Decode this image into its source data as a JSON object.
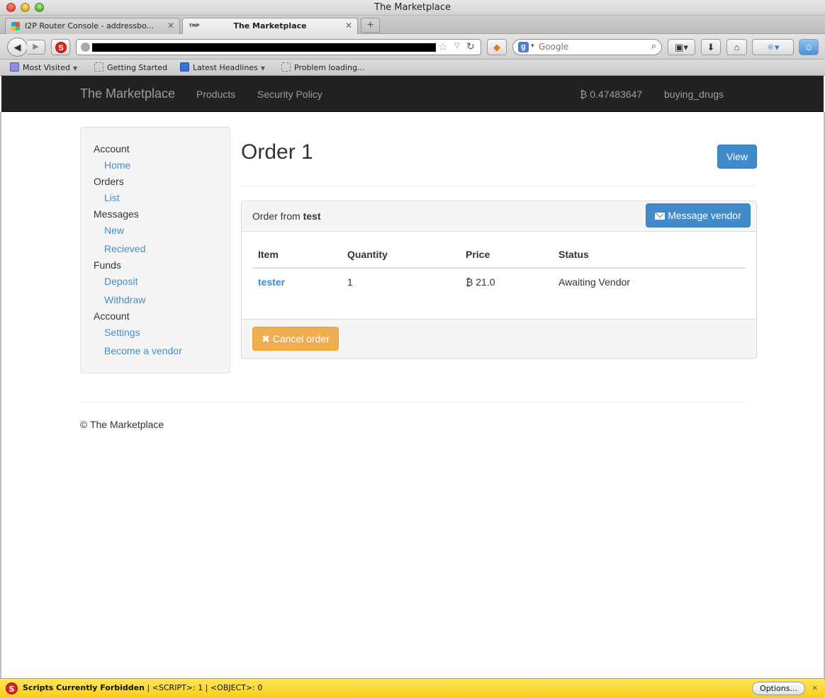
{
  "window": {
    "title": "The Marketplace"
  },
  "tabs": [
    {
      "label": "I2P Router Console - addressbo...",
      "favicon": "i2p-icon"
    },
    {
      "label": "The Marketplace",
      "favicon": "tmp-icon",
      "favicon_text": "TMP"
    }
  ],
  "toolbar": {
    "search_placeholder": "Google",
    "search_engine_letter": "g"
  },
  "bookmarks": [
    {
      "label": "Most Visited",
      "icon": "folder-icon"
    },
    {
      "label": "Getting Started",
      "icon": "bookmark-icon"
    },
    {
      "label": "Latest Headlines",
      "icon": "rss-icon"
    },
    {
      "label": "Problem loading...",
      "icon": "bookmark-icon"
    }
  ],
  "site_nav": {
    "brand": "The Marketplace",
    "links": [
      "Products",
      "Security Policy"
    ],
    "balance": "₿ 0.47483647",
    "username": "buying_drugs"
  },
  "sidebar": {
    "sections": [
      {
        "heading": "Account",
        "links": [
          "Home"
        ]
      },
      {
        "heading": "Orders",
        "links": [
          "List"
        ]
      },
      {
        "heading": "Messages",
        "links": [
          "New",
          "Recieved"
        ]
      },
      {
        "heading": "Funds",
        "links": [
          "Deposit",
          "Withdraw"
        ]
      },
      {
        "heading": "Account",
        "links": [
          "Settings",
          "Become a vendor"
        ]
      }
    ]
  },
  "main": {
    "title": "Order 1",
    "view_button": "View",
    "panel": {
      "heading_prefix": "Order from",
      "vendor": "test",
      "message_button": "Message vendor",
      "columns": [
        "Item",
        "Quantity",
        "Price",
        "Status"
      ],
      "rows": [
        {
          "item": "tester",
          "quantity": "1",
          "price": "₿ 21.0",
          "status": "Awaiting Vendor"
        }
      ],
      "cancel_button": "✖ Cancel order"
    }
  },
  "footer": {
    "text": "© The Marketplace"
  },
  "noscript_bar": {
    "status": "Scripts Currently Forbidden",
    "details": "| <SCRIPT>: 1 | <OBJECT>: 0",
    "options_button": "Options...",
    "close": "×"
  },
  "colors": {
    "primary": "#428bca",
    "warning": "#f0ad4e",
    "navbar": "#222222",
    "noscript_bar": "#f7cf1a"
  }
}
